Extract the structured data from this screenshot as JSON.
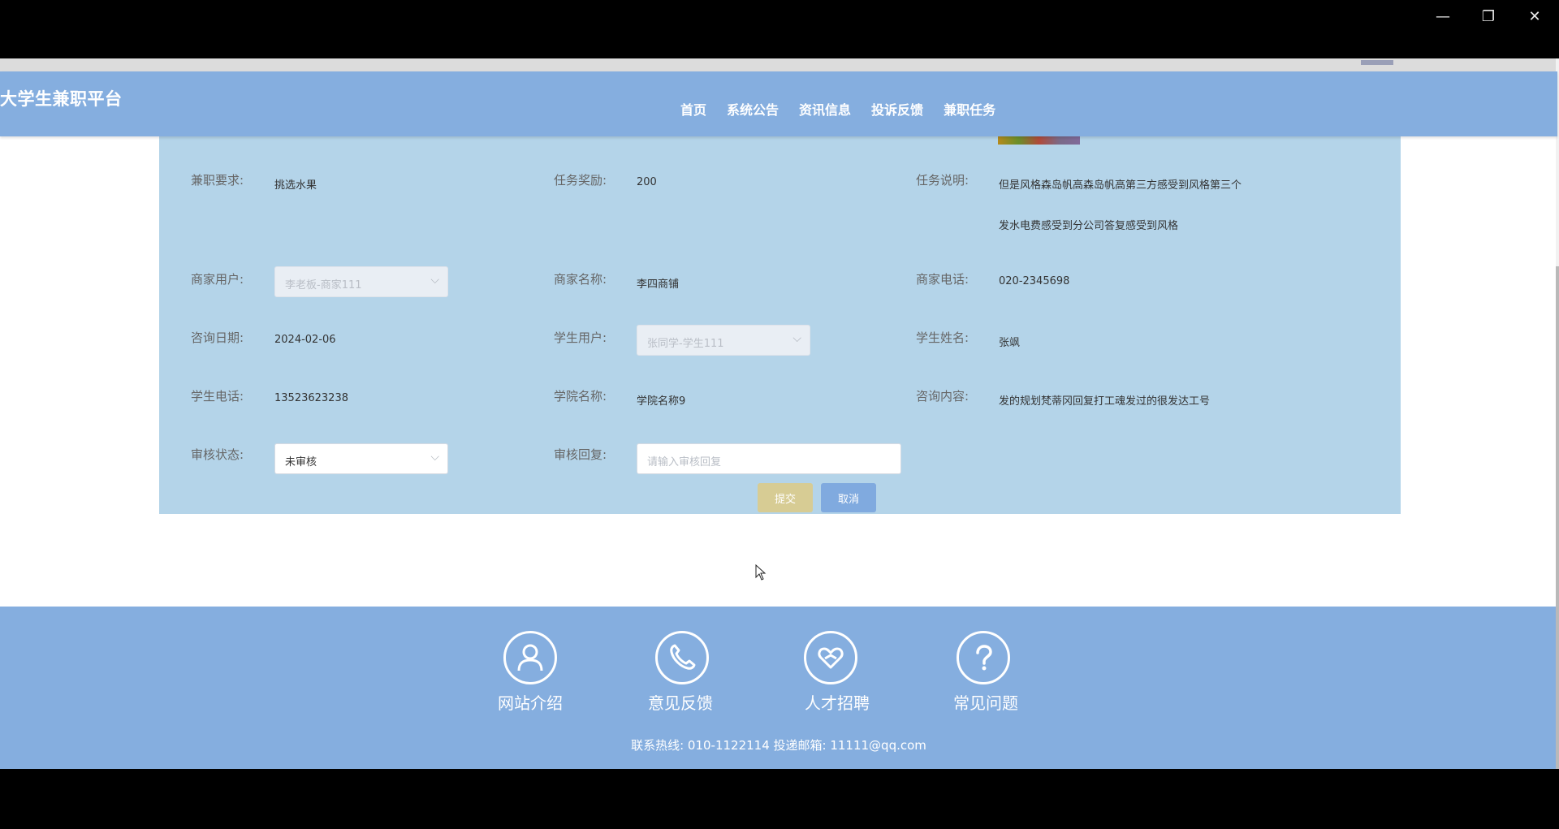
{
  "window": {
    "minimize_icon": "—",
    "restore_icon": "❐",
    "close_icon": "✕"
  },
  "header": {
    "logo": "大学生兼职平台",
    "nav": [
      "首页",
      "系统公告",
      "资讯信息",
      "投诉反馈",
      "兼职任务"
    ]
  },
  "form": {
    "fields": {
      "job_requirement": {
        "label": "兼职要求:",
        "value": "挑选水果"
      },
      "task_reward": {
        "label": "任务奖励:",
        "value": "200"
      },
      "task_description": {
        "label": "任务说明:",
        "value_line1": "但是风格森岛帆高森岛帆高第三方感受到风格第三个",
        "value_line2": "发水电费感受到分公司答复感受到风格"
      },
      "merchant_user": {
        "label": "商家用户:",
        "value": "李老板-商家111"
      },
      "merchant_name": {
        "label": "商家名称:",
        "value": "李四商铺"
      },
      "merchant_phone": {
        "label": "商家电话:",
        "value": "020-2345698"
      },
      "consult_date": {
        "label": "咨询日期:",
        "value": "2024-02-06"
      },
      "student_user": {
        "label": "学生用户:",
        "value": "张同学-学生111"
      },
      "student_name": {
        "label": "学生姓名:",
        "value": "张飒"
      },
      "student_phone": {
        "label": "学生电话:",
        "value": "13523623238"
      },
      "college_name": {
        "label": "学院名称:",
        "value": "学院名称9"
      },
      "consult_content": {
        "label": "咨询内容:",
        "value": "发的规划梵蒂冈回复打工魂发过的很发达工号"
      },
      "review_status": {
        "label": "审核状态:",
        "value": "未审核"
      },
      "review_reply": {
        "label": "审核回复:",
        "placeholder": "请输入审核回复"
      }
    },
    "submit_label": "提交",
    "cancel_label": "取消"
  },
  "footer": {
    "items": [
      {
        "label": "网站介绍",
        "icon": "user-icon"
      },
      {
        "label": "意见反馈",
        "icon": "phone-icon"
      },
      {
        "label": "人才招聘",
        "icon": "heart-icon"
      },
      {
        "label": "常见问题",
        "icon": "question-icon"
      }
    ],
    "contact": "联系热线: 010-1122114 投递邮箱: 11111@qq.com"
  },
  "colors": {
    "header": "#85aedf",
    "panel": "#b4d4e9",
    "submit": "#d7cc94",
    "cancel": "#80aadf"
  }
}
